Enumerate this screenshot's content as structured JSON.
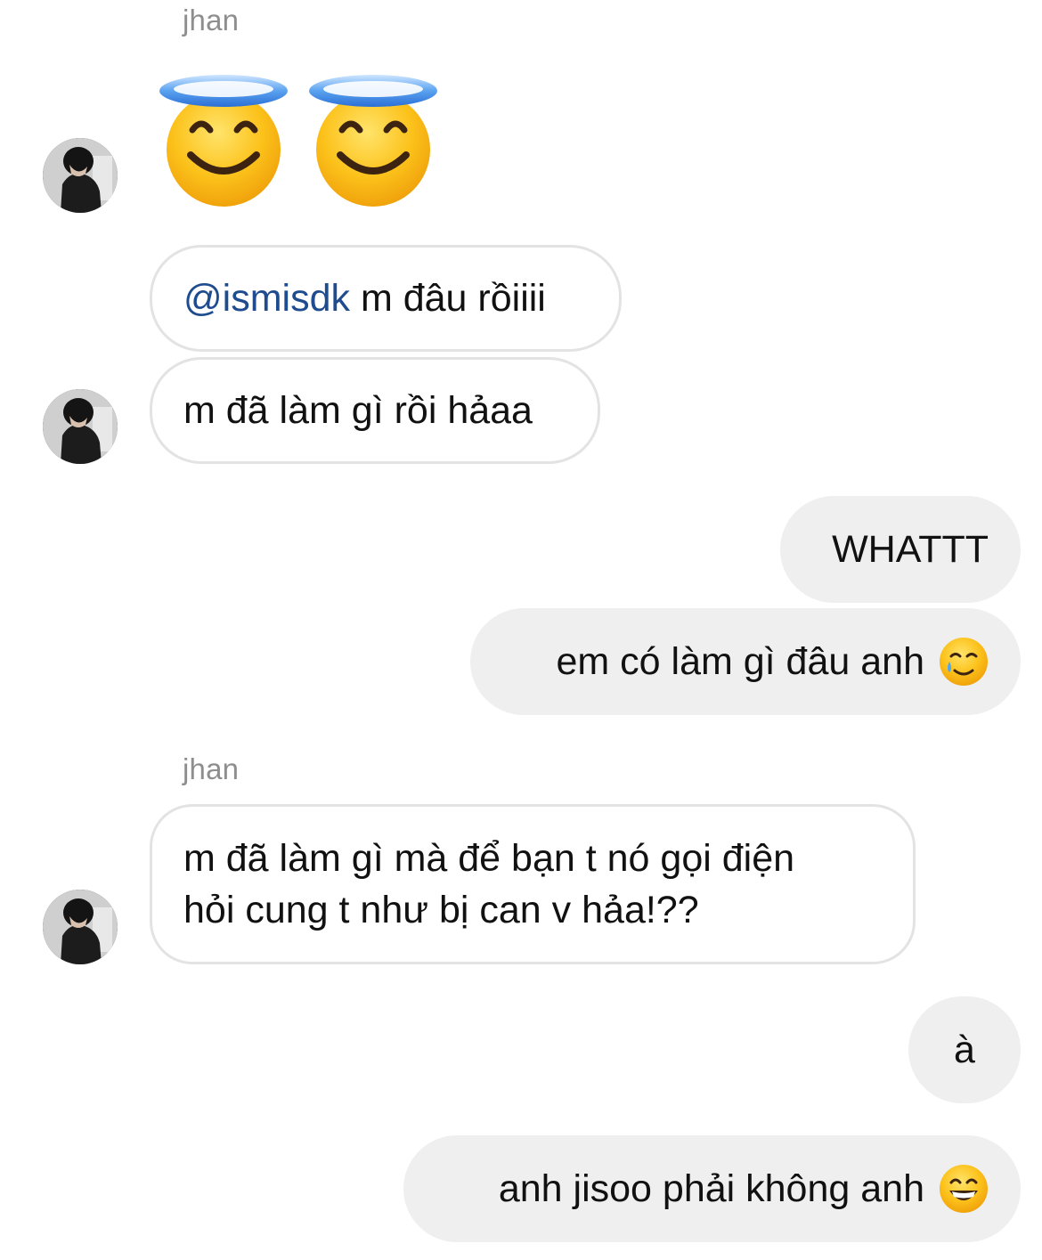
{
  "thread": {
    "sender_name_1": "jhan",
    "sender_name_2": "jhan",
    "messages": [
      {
        "emoji": "smiling-face-with-halo-icon"
      },
      {
        "mention": "@ismisdk",
        "text": " m đâu rồiiii"
      },
      {
        "text": "m đã làm gì rồi hảaa"
      },
      {
        "text": "WHATTT"
      },
      {
        "text": "em có làm gì đâu anh",
        "emoji": "smiling-face-with-tear-icon"
      },
      {
        "line1": "m đã làm gì mà để bạn t nó gọi điện",
        "line2": "hỏi cung t như bị can v hảa!??"
      },
      {
        "text": "à"
      },
      {
        "text": "anh jisoo phải không anh",
        "emoji": "grinning-face-icon"
      }
    ]
  },
  "colors": {
    "incoming_bubble_border": "#e3e3e3",
    "outgoing_bubble_bg": "#efefef",
    "mention": "#1f4b8f",
    "sender_name": "#8e8e8e"
  }
}
